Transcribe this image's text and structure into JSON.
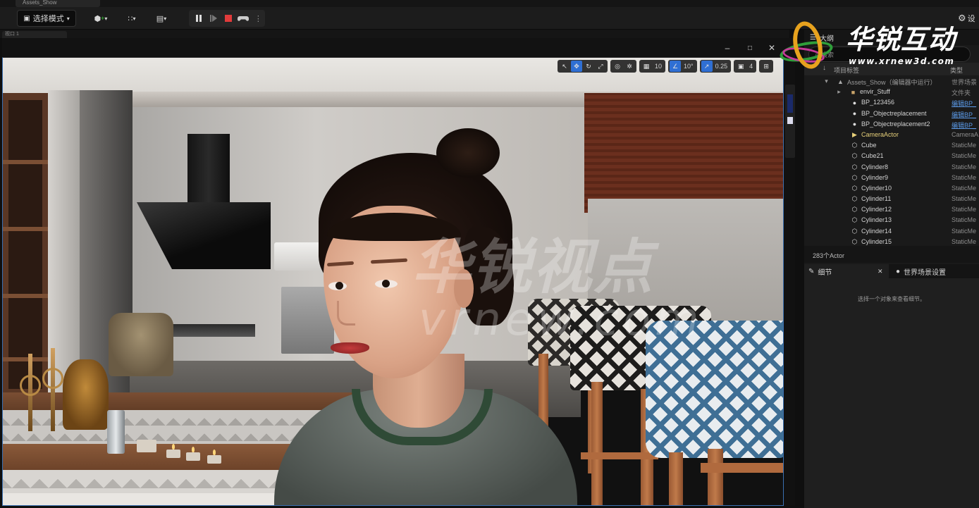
{
  "window": {
    "tab_title": "Assets_Show"
  },
  "toolbar": {
    "mode_label": "选择模式",
    "settings_label": "设"
  },
  "subtab": {
    "label": "视口 1"
  },
  "viewport": {
    "grid_value": "10",
    "angle_value": "10°",
    "scale_value": "0.25",
    "camera_speed": "4"
  },
  "scene": {
    "watermark_cn": "华锐视点",
    "watermark_en": "vrnew.com"
  },
  "logo": {
    "name": "华锐互动",
    "url": "www.xrnew3d.com"
  },
  "outliner": {
    "title": "大纲",
    "search_placeholder": "搜索",
    "col_label": "项目标签",
    "col_type": "类型",
    "rows": [
      {
        "label": "Assets_Show（编辑器中运行）",
        "type": "世界场景",
        "icon": "world-icon"
      },
      {
        "label": "envir_Stuff",
        "type": "文件夹",
        "icon": "folder-icon"
      },
      {
        "label": "BP_123456",
        "type": "编辑BP_",
        "icon": "actor-icon",
        "link": true
      },
      {
        "label": "BP_Objectreplacement",
        "type": "编辑BP_",
        "icon": "actor-icon",
        "link": true
      },
      {
        "label": "BP_Objectreplacement2",
        "type": "编辑BP_",
        "icon": "actor-icon",
        "link": true
      },
      {
        "label": "CameraActor",
        "type": "CameraA",
        "icon": "camera-icon"
      },
      {
        "label": "Cube",
        "type": "StaticMe",
        "icon": "mesh-icon"
      },
      {
        "label": "Cube21",
        "type": "StaticMe",
        "icon": "mesh-icon"
      },
      {
        "label": "Cylinder8",
        "type": "StaticMe",
        "icon": "mesh-icon"
      },
      {
        "label": "Cylinder9",
        "type": "StaticMe",
        "icon": "mesh-icon"
      },
      {
        "label": "Cylinder10",
        "type": "StaticMe",
        "icon": "mesh-icon"
      },
      {
        "label": "Cylinder11",
        "type": "StaticMe",
        "icon": "mesh-icon"
      },
      {
        "label": "Cylinder12",
        "type": "StaticMe",
        "icon": "mesh-icon"
      },
      {
        "label": "Cylinder13",
        "type": "StaticMe",
        "icon": "mesh-icon"
      },
      {
        "label": "Cylinder14",
        "type": "StaticMe",
        "icon": "mesh-icon"
      },
      {
        "label": "Cylinder15",
        "type": "StaticMe",
        "icon": "mesh-icon"
      }
    ],
    "actor_count": "283个Actor"
  },
  "details": {
    "tab_details": "细节",
    "tab_world": "世界场景设置",
    "empty_text": "选择一个对象来查看细节。"
  }
}
